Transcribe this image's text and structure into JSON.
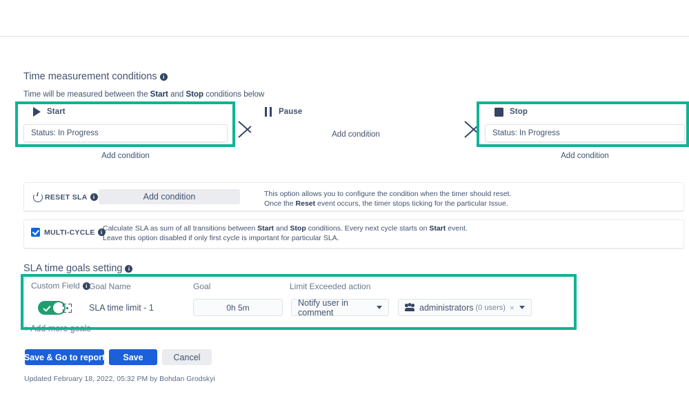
{
  "sections": {
    "time_measurement": {
      "title": "Time measurement conditions",
      "hint_prefix": "Time will be measured between the ",
      "hint_start": "Start",
      "hint_mid": " and ",
      "hint_stop": "Stop",
      "hint_suffix": " conditions below"
    },
    "sla_goals": {
      "title": "SLA time goals setting"
    }
  },
  "conditions": {
    "start": {
      "label": "Start",
      "icon": "play-icon",
      "value": "Status: In Progress",
      "add_condition": "Add condition"
    },
    "pause": {
      "label": "Pause",
      "icon": "pause-icon",
      "add_condition": "Add condition"
    },
    "stop": {
      "label": "Stop",
      "icon": "stop-icon",
      "value": "Status: In Progress",
      "add_condition": "Add condition"
    }
  },
  "reset_sla": {
    "label": "RESET SLA",
    "icon": "power-icon",
    "button_label": "Add condition",
    "description_line1_a": "This option allows you to configure the condition when the timer should reset.",
    "description_line2_a": "Once the ",
    "description_line2_b": "Reset",
    "description_line2_c": " event occurs, the timer stops ticking for the particular Issue."
  },
  "multi_cycle": {
    "label": "MULTI-CYCLE",
    "checked": true,
    "desc1_a": "Calculate SLA as sum of all transitions between ",
    "desc1_b": "Start",
    "desc1_c": " and ",
    "desc1_d": "Stop",
    "desc1_e": " conditions. Every next cycle starts on ",
    "desc1_f": "Start",
    "desc1_g": " event.",
    "desc2": "Leave this option disabled if only first cycle is important for particular SLA."
  },
  "goals_table": {
    "headers": {
      "custom_field": "Custom Field",
      "goal_name": "Goal Name",
      "goal": "Goal",
      "limit_exceeded": "Limit Exceeded action"
    },
    "row": {
      "toggle_on": true,
      "name": "SLA time limit - 1",
      "goal_value": "0h 5m",
      "action": "Notify user in comment",
      "recipient": "administrators",
      "recipient_count": "(0 users)",
      "remove": "×"
    },
    "add_more": "+ Add more goals"
  },
  "footer": {
    "save_go_report": "Save & Go to report",
    "save": "Save",
    "cancel": "Cancel",
    "updated": "Updated February 18, 2022, 05:32 PM by Bohdan Grodskyi"
  },
  "colors": {
    "highlight": "#0FB494",
    "primary_button": "#1B5FD9",
    "toggle_on": "#1F9E6E",
    "checkbox": "#0C66E4"
  }
}
